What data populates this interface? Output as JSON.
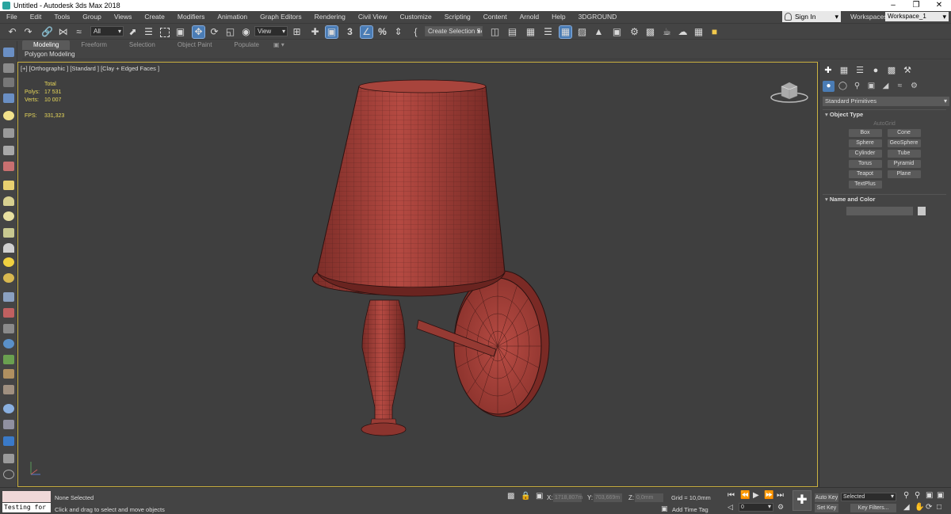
{
  "window": {
    "title": "Untitled - Autodesk 3ds Max 2018",
    "minimize": "–",
    "maximize": "❐",
    "close": "✕"
  },
  "menu": [
    "File",
    "Edit",
    "Tools",
    "Group",
    "Views",
    "Create",
    "Modifiers",
    "Animation",
    "Graph Editors",
    "Rendering",
    "Civil View",
    "Customize",
    "Scripting",
    "Content",
    "Arnold",
    "Help",
    "3DGROUND"
  ],
  "account": {
    "sign_in": "Sign In",
    "workspaces_label": "Workspaces:",
    "workspace": "Workspace_1"
  },
  "toolbar": {
    "selection_filter": "All",
    "reference_coord": "View",
    "named_selection": "Create Selection Se",
    "snap_label": "3",
    "percent_snap": "%"
  },
  "ribbon": {
    "tabs": [
      "Modeling",
      "Freeform",
      "Selection",
      "Object Paint",
      "Populate"
    ],
    "active_tab": "Modeling",
    "subpanel": "Polygon Modeling"
  },
  "viewport": {
    "label": "[+] [Orthographic ] [Standard ] [Clay + Edged Faces ]",
    "stats": {
      "total_label": "Total",
      "polys_label": "Polys:",
      "polys": "17 531",
      "verts_label": "Verts:",
      "verts": "10 007",
      "fps_label": "FPS:",
      "fps": "331,323"
    },
    "object_color": "#a6413a",
    "background_color": "#3f3f3f",
    "highlight_color": "#c9b040"
  },
  "command_panel": {
    "dropdown": "Standard Primitives",
    "object_type": {
      "title": "Object Type",
      "autogrid": "AutoGrid",
      "buttons": [
        "Box",
        "Cone",
        "Sphere",
        "GeoSphere",
        "Cylinder",
        "Tube",
        "Torus",
        "Pyramid",
        "Teapot",
        "Plane",
        "TextPlus"
      ]
    },
    "name_color": {
      "title": "Name and Color"
    }
  },
  "status": {
    "maxscript_output": "Testing for :",
    "selection": "None Selected",
    "prompt": "Click and drag to select and move objects",
    "x_label": "X:",
    "x_value": "1718,807m",
    "y_label": "Y:",
    "y_value": "703,669m",
    "z_label": "Z:",
    "z_value": "0,0mm",
    "grid": "Grid = 10,0mm",
    "add_time_tag": "Add Time Tag",
    "frame": "0",
    "auto_key": "Auto Key",
    "set_key": "Set Key",
    "selected_dd": "Selected",
    "key_filters": "Key Filters..."
  }
}
